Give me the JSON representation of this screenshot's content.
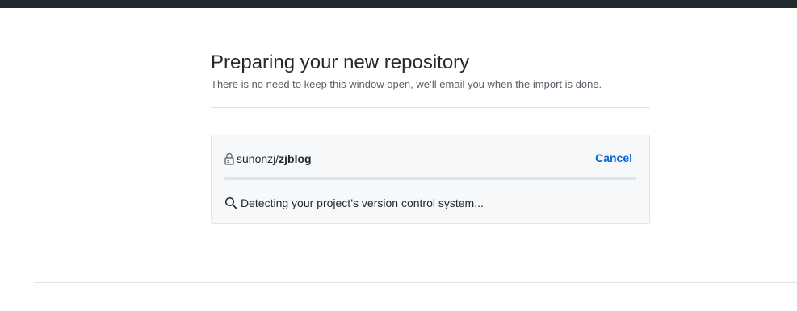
{
  "header": {
    "title": "Preparing your new repository",
    "subtitle": "There is no need to keep this window open, we’ll email you when the import is done."
  },
  "import": {
    "lock_icon": "lock-icon",
    "owner": "sunonzj",
    "separator": "/",
    "repo": "zjblog",
    "cancel_label": "Cancel",
    "progress": 0,
    "status_icon": "search-icon",
    "status_text": "Detecting your project’s version control system..."
  },
  "colors": {
    "topbar": "#24292e",
    "link": "#0366d6",
    "box_bg": "#f6f8fa",
    "border": "#e1e4e8"
  }
}
